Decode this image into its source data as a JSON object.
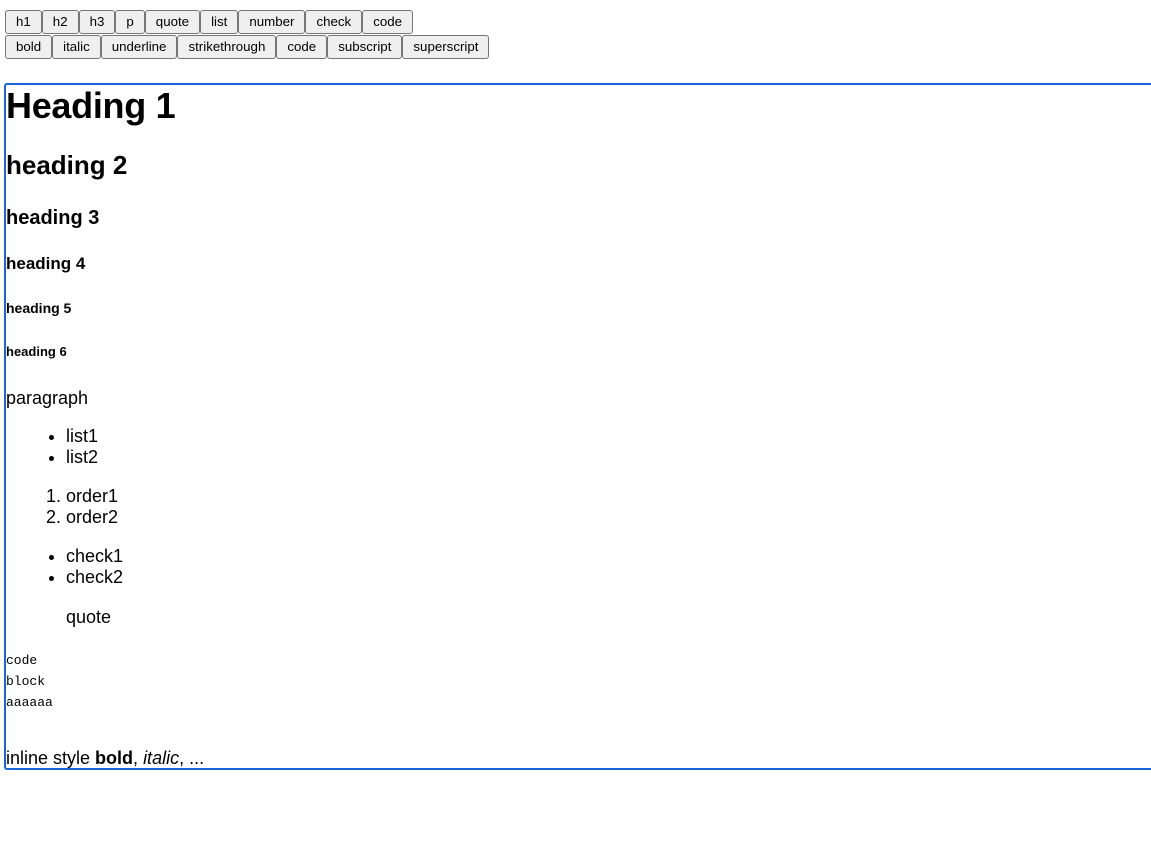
{
  "toolbar": {
    "block_buttons": [
      "h1",
      "h2",
      "h3",
      "p",
      "quote",
      "list",
      "number",
      "check",
      "code"
    ],
    "inline_buttons": [
      "bold",
      "italic",
      "underline",
      "strikethrough",
      "code",
      "subscript",
      "superscript"
    ]
  },
  "editor": {
    "heading1": "Heading 1",
    "heading2": "heading 2",
    "heading3": "heading 3",
    "heading4": "heading 4",
    "heading5": "heading 5",
    "heading6": "heading 6",
    "paragraph": "paragraph",
    "bullet_list": [
      "list1",
      "list2"
    ],
    "ordered_list": [
      "order1",
      "order2"
    ],
    "check_list": [
      "check1",
      "check2"
    ],
    "quote": "quote",
    "code_block": [
      "code",
      "block",
      "aaaaaa"
    ],
    "inline": {
      "prefix": "inline style ",
      "bold": "bold",
      "sep1": ", ",
      "italic": "italic",
      "suffix": ", ..."
    },
    "accent_color": "#1a64d9"
  }
}
